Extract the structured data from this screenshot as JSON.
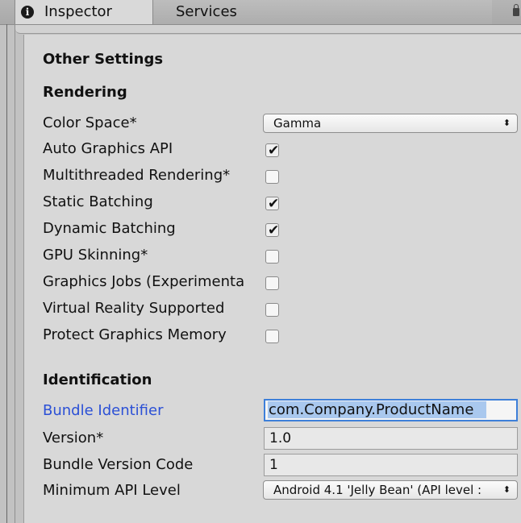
{
  "tabs": {
    "inspector_label": "Inspector",
    "services_label": "Services",
    "inspector_icon": "info-icon",
    "lock_icon": "lock-icon"
  },
  "section": {
    "title": "Other Settings"
  },
  "rendering": {
    "heading": "Rendering",
    "color_space": {
      "label": "Color Space*",
      "value": "Gamma"
    },
    "checkboxes": [
      {
        "label": "Auto Graphics API",
        "checked": true
      },
      {
        "label": "Multithreaded Rendering*",
        "checked": false
      },
      {
        "label": "Static Batching",
        "checked": true
      },
      {
        "label": "Dynamic Batching",
        "checked": true
      },
      {
        "label": "GPU Skinning*",
        "checked": false
      },
      {
        "label": "Graphics Jobs (Experimenta",
        "checked": false
      },
      {
        "label": "Virtual Reality Supported",
        "checked": false
      },
      {
        "label": "Protect Graphics Memory",
        "checked": false
      }
    ]
  },
  "identification": {
    "heading": "Identification",
    "bundle_identifier": {
      "label": "Bundle Identifier",
      "value": "com.Company.ProductName"
    },
    "version": {
      "label": "Version*",
      "value": "1.0"
    },
    "bundle_version_code": {
      "label": "Bundle Version Code",
      "value": "1"
    },
    "min_api_level": {
      "label": "Minimum API Level",
      "value": "Android 4.1 'Jelly Bean' (API level :"
    }
  },
  "colors": {
    "accent_blue": "#2b50d6",
    "focus_border": "#3d7fd9",
    "selection": "#a9c8ee"
  }
}
